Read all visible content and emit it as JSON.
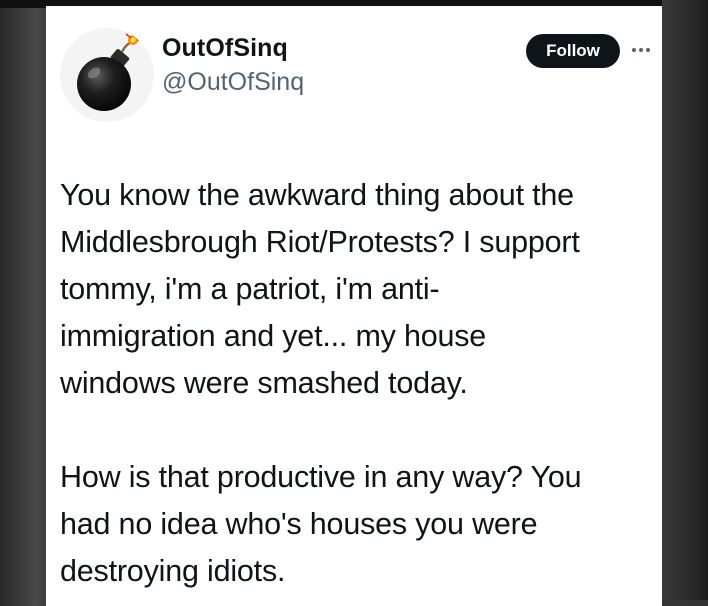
{
  "post": {
    "author": {
      "display_name": "OutOfSinq",
      "handle": "@OutOfSinq",
      "avatar_icon": "bomb-icon"
    },
    "follow_label": "Follow",
    "more_icon": "more-options-icon",
    "paragraphs": [
      "You know the awkward thing about the\nMiddlesbrough Riot/Protests? I support\ntommy, i'm a patriot, i'm anti-\nimmigration and yet... my house\nwindows were smashed today.",
      "How is that productive in any way? You\nhad no idea who's houses you were\ndestroying idiots."
    ]
  },
  "colors": {
    "text": "#0f1419",
    "secondary_text": "#536471",
    "follow_button_bg": "#0f1419",
    "follow_button_text": "#ffffff",
    "card_bg": "#ffffff",
    "background": "#333333"
  }
}
